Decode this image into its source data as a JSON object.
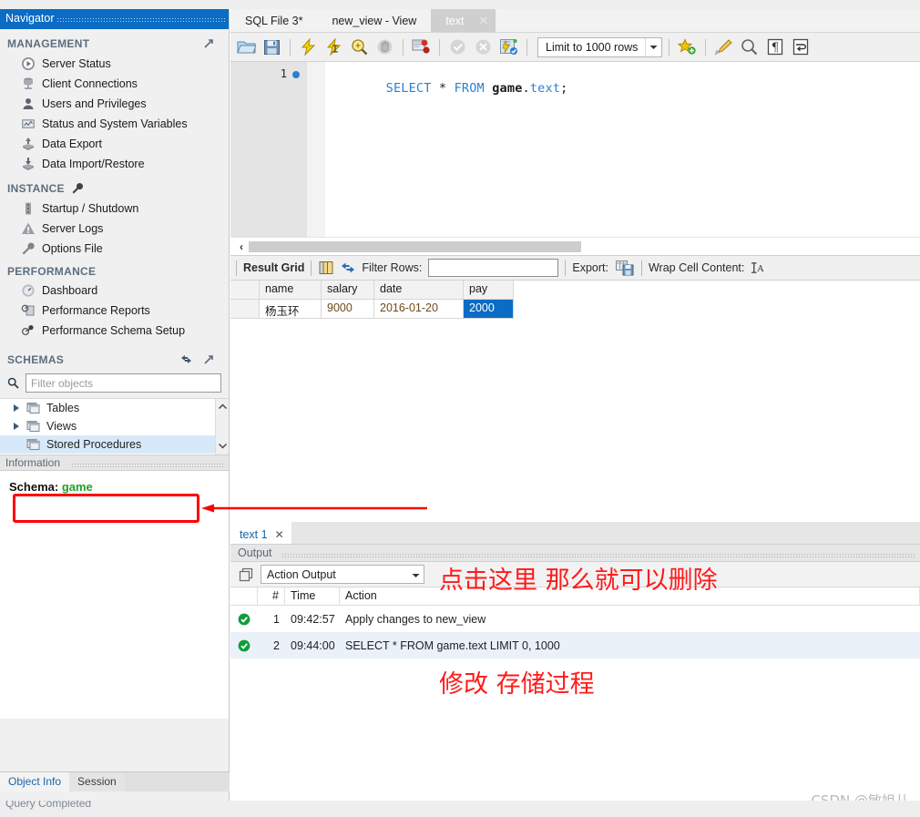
{
  "sidebar": {
    "navigator_title": "Navigator",
    "sections": [
      {
        "name": "MANAGEMENT",
        "items": [
          {
            "label": "Server Status",
            "icon": "server-status-icon"
          },
          {
            "label": "Client Connections",
            "icon": "client-connections-icon"
          },
          {
            "label": "Users and Privileges",
            "icon": "users-privileges-icon"
          },
          {
            "label": "Status and System Variables",
            "icon": "status-variables-icon"
          },
          {
            "label": "Data Export",
            "icon": "data-export-icon"
          },
          {
            "label": "Data Import/Restore",
            "icon": "data-import-icon"
          }
        ]
      },
      {
        "name": "INSTANCE",
        "items": [
          {
            "label": "Startup / Shutdown",
            "icon": "startup-shutdown-icon"
          },
          {
            "label": "Server Logs",
            "icon": "server-logs-icon"
          },
          {
            "label": "Options File",
            "icon": "options-file-icon"
          }
        ]
      },
      {
        "name": "PERFORMANCE",
        "items": [
          {
            "label": "Dashboard",
            "icon": "dashboard-icon"
          },
          {
            "label": "Performance Reports",
            "icon": "performance-reports-icon"
          },
          {
            "label": "Performance Schema Setup",
            "icon": "performance-schema-icon"
          }
        ]
      },
      {
        "name": "SCHEMAS",
        "items": []
      }
    ],
    "filter_placeholder": "Filter objects",
    "filter_value": "",
    "tree": [
      {
        "label": "Tables",
        "expandable": true,
        "selected": false
      },
      {
        "label": "Views",
        "expandable": true,
        "selected": false
      },
      {
        "label": "Stored Procedures",
        "expandable": false,
        "selected": true
      }
    ],
    "information_title": "Information",
    "schema_label": "Schema:",
    "schema_value": "game",
    "tabs": [
      {
        "label": "Object Info",
        "active": true
      },
      {
        "label": "Session",
        "active": false
      }
    ]
  },
  "editor": {
    "tabs": [
      {
        "label": "SQL File 3*",
        "active": false,
        "closable": false
      },
      {
        "label": "new_view - View",
        "active": false,
        "closable": false
      },
      {
        "label": "text",
        "active": true,
        "closable": true
      }
    ],
    "toolbar": {
      "icons": [
        "open-file-icon",
        "save-file-icon",
        "execute-icon",
        "execute-current-icon",
        "explain-icon",
        "stop-icon",
        "toggle-breakpoint-icon",
        "commit-icon",
        "rollback-icon",
        "autocommit-icon"
      ],
      "limit_label": "Limit to 1000 rows",
      "right_icons": [
        "add-snippet-icon",
        "beautify-sql-icon",
        "find-icon",
        "invisible-chars-icon",
        "wrap-lines-icon"
      ]
    },
    "line_number": "1",
    "sql": "SELECT * FROM game.text;",
    "sql_tokens": [
      {
        "t": "SELECT",
        "k": "kw"
      },
      {
        "t": " ",
        "k": "ws"
      },
      {
        "t": "*",
        "k": "op"
      },
      {
        "t": " ",
        "k": "ws"
      },
      {
        "t": "FROM",
        "k": "kw"
      },
      {
        "t": " ",
        "k": "ws"
      },
      {
        "t": "game",
        "k": "id"
      },
      {
        "t": ".",
        "k": "pn"
      },
      {
        "t": "text",
        "k": "tbl"
      },
      {
        "t": ";",
        "k": "pn"
      }
    ]
  },
  "result_toolbar": {
    "result_grid_label": "Result Grid",
    "filter_rows_label": "Filter Rows:",
    "filter_rows_value": "",
    "export_label": "Export:",
    "wrap_label": "Wrap Cell Content:"
  },
  "result_grid": {
    "columns": [
      "name",
      "salary",
      "date",
      "pay"
    ],
    "rows": [
      {
        "cells": [
          "杨玉环",
          "9000",
          "2016-01-20",
          "2000"
        ],
        "selected_index": 3
      }
    ]
  },
  "bottom": {
    "tab_label": "text 1",
    "output_title": "Output",
    "output_selector": "Action Output",
    "columns": [
      "#",
      "Time",
      "Action"
    ],
    "entries": [
      {
        "status": "ok",
        "num": "1",
        "time": "09:42:57",
        "action": "Apply changes to new_view"
      },
      {
        "status": "ok",
        "num": "2",
        "time": "09:44:00",
        "action": "SELECT * FROM game.text LIMIT 0, 1000"
      }
    ]
  },
  "annotation": {
    "line1": "点击这里 那么就可以删除",
    "line2": "修改 存储过程",
    "color": "#ff1a1a"
  },
  "watermark": "CSDN @敏姐儿",
  "status_text": "Query Completed",
  "colors": {
    "accent": "#0a6cc4",
    "selection": "#d7e9f9",
    "schema_green": "#22a02a",
    "annotation_red": "#ff0000"
  }
}
